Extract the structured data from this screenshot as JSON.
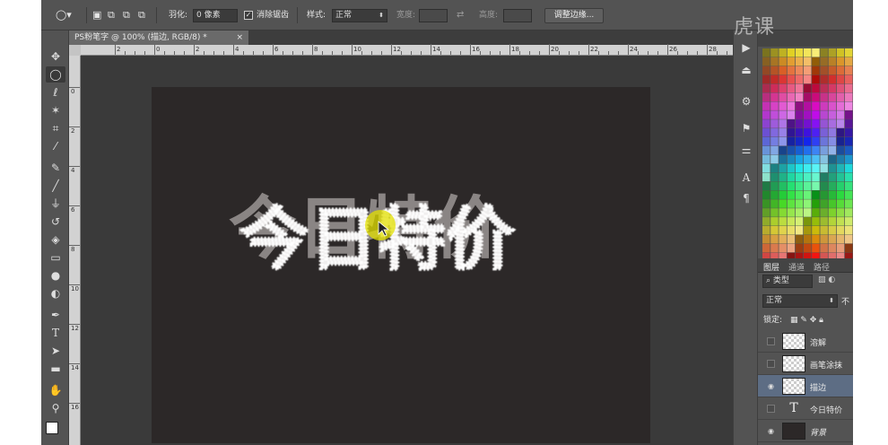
{
  "app": {
    "watermark": "虎课"
  },
  "options_bar": {
    "feather_label": "羽化:",
    "feather_value": "0 像素",
    "antialias_label": "消除锯齿",
    "style_label": "样式:",
    "style_value": "正常",
    "width_label": "宽度:",
    "height_label": "高度:",
    "refine_button": "调整边缘..."
  },
  "document": {
    "tab_title": "PS粉笔字 @ 100% (描边, RGB/8) *",
    "close": "×",
    "canvas_text": "今日特价",
    "ruler_h": [
      "2",
      "0",
      "2",
      "4",
      "6",
      "8",
      "10",
      "12",
      "14",
      "16",
      "18",
      "20",
      "22",
      "24",
      "26",
      "28"
    ],
    "ruler_v": [
      "0",
      "2",
      "4",
      "6",
      "8",
      "10",
      "12",
      "14",
      "16"
    ]
  },
  "layers_panel": {
    "tabs": [
      "图层",
      "通道",
      "路径"
    ],
    "filter_value": "类型",
    "blend_value": "正常",
    "opacity_label": "不",
    "lock_label": "锁定:",
    "layers": [
      {
        "name": "溶解",
        "visible": false,
        "type": "pixel"
      },
      {
        "name": "画笔涂抹",
        "visible": false,
        "type": "pixel"
      },
      {
        "name": "描边",
        "visible": true,
        "type": "pixel",
        "selected": true
      },
      {
        "name": "今日特价",
        "visible": false,
        "type": "text"
      },
      {
        "name": "背景",
        "visible": true,
        "type": "background"
      }
    ]
  },
  "colors": {
    "app_bg": "#535353",
    "canvas_bg": "#2c2828",
    "highlight": "#e3e000",
    "selected_layer": "#5d6d84"
  },
  "icons": [
    "move-icon",
    "elliptical-marquee-icon",
    "lasso-icon",
    "magic-wand-icon",
    "crop-icon",
    "eyedropper-icon",
    "healing-brush-icon",
    "brush-icon",
    "clone-stamp-icon",
    "history-brush-icon",
    "eraser-icon",
    "gradient-icon",
    "blur-icon",
    "dodge-icon",
    "pen-icon",
    "type-icon",
    "path-selection-icon",
    "rectangle-icon",
    "hand-icon",
    "zoom-icon"
  ]
}
